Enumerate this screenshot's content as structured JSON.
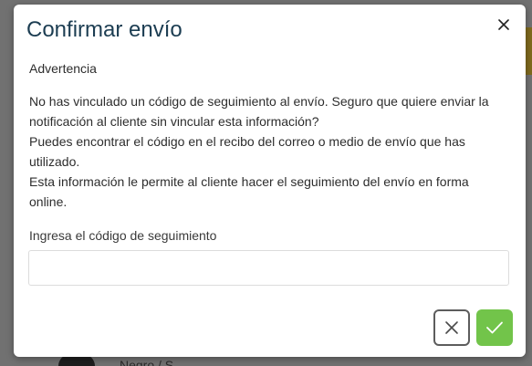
{
  "modal": {
    "title": "Confirmar envío",
    "warning": "Advertencia",
    "message_lines": [
      "No has vinculado un código de seguimiento al envío. Seguro que quiere enviar la notificación al cliente sin vincular esta información?",
      "Puedes encontrar el código en el recibo del correo o medio de envío que has utilizado.",
      "Esta información le permite al cliente hacer el seguimiento del envío en forma online."
    ],
    "tracking_label": "Ingresa el código de seguimiento",
    "tracking_value": "",
    "close_icon": "close-icon",
    "cancel_icon": "x-icon",
    "confirm_icon": "check-icon"
  },
  "background": {
    "product_variant": "Negro / S"
  },
  "colors": {
    "title": "#1c3d52",
    "confirm": "#72c44a",
    "cancel_border": "#5d5d5d",
    "overlay": "#717171"
  }
}
